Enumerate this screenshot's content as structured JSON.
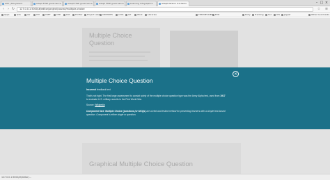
{
  "browser": {
    "tabs": [
      {
        "label": "AVE | Storyboard"
      },
      {
        "label": "Adapt FTSE governance"
      },
      {
        "label": "Adapt FTSE governance"
      },
      {
        "label": "Adapt FTSE governance"
      },
      {
        "label": "Learning Infographics"
      },
      {
        "label": "Adapt Version 2.0 demo"
      }
    ],
    "address": "127.0.0.1:5000/#/editor/project/course/multiple-choice",
    "bookmarks": [
      "Apps",
      "Q2u",
      "Aw",
      "CM",
      "CSET",
      "CPD",
      "LRA",
      "Profiler",
      "Project Lead",
      "CRONOPS",
      "sCOL",
      "Git",
      "Work",
      "Libraries",
      "TESTDEVICES",
      "EVD",
      "Dolly",
      "Tracking",
      "Soc",
      "UIS",
      "Jaguar",
      "Other bookmarks"
    ]
  },
  "background": {
    "card_title": "Multiple Choice Question",
    "bottom_title": "Graphical Multiple Choice Question"
  },
  "modal": {
    "title": "Multiple Choice Question",
    "close_label": "×",
    "feedback_label": "Incorrect",
    "feedback_text": " feedback text",
    "paragraph1": "That's not right. The first large assessment to consist solely of the multiple choice question type was the Army Alpha test, used from",
    "year": "1917",
    "paragraph1b": "to evaluate U.S. military recruits in the First World War.",
    "source_label": "Source: ",
    "source_link": "Wikipedia",
    "fact_prefix": "Component fact: ",
    "fact_bold": "Multiple Choice Questions (or MCQs)",
    "fact_text": " are a tried and tested method for presenting learners with a simple text-based",
    "fact_text2": "question. Component is either single or question."
  },
  "status": {
    "text": "127.0.0.1:5000/#/editor/..."
  }
}
